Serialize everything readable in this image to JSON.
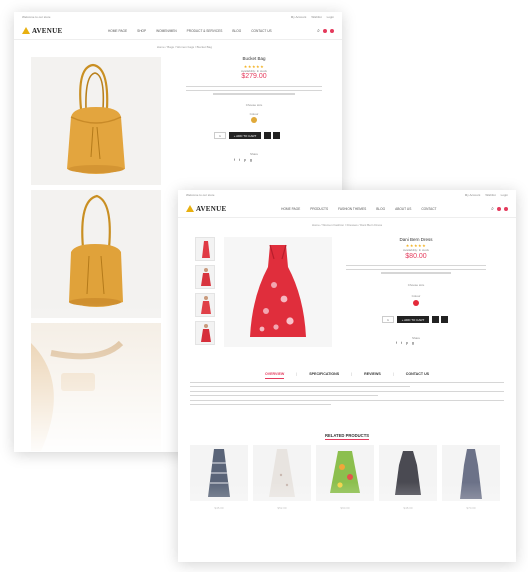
{
  "brand": {
    "logo_text": "AVENUE",
    "accent": "#e43a5c",
    "star_color": "#f2b01e"
  },
  "back_page": {
    "topbar_left": "Welcome to our store",
    "topbar_right": [
      "My Account",
      "Wishlist",
      "Login"
    ],
    "menu": [
      "Home page",
      "Shop",
      "Women/Men",
      "Product & Services",
      "Blog",
      "Contact us"
    ],
    "breadcrumb": "Home / Bags / Women bags / Bucket Bag",
    "product": {
      "name": "Bucket Bag",
      "price": "$279.00",
      "availability": "Availability: In stock",
      "size_label": "Choose size",
      "color_label": "Colour",
      "qty": "1",
      "cart_label": "+ ADD TO CART",
      "share_label": "Share",
      "swatch_color": "#e0a93a"
    }
  },
  "front_page": {
    "topbar_left": "Welcome to our store",
    "topbar_right": [
      "My Account",
      "Wishlist",
      "Login"
    ],
    "menu": [
      "Home page",
      "Products",
      "Fashion Themes",
      "Blog",
      "About us",
      "Contact"
    ],
    "breadcrumb": "Home / Women Fashion / Dresses / Dani Bern Dress",
    "product": {
      "name": "Dani Bern Dress",
      "price": "$80.00",
      "availability": "Availability: In stock",
      "size_label": "Choose size",
      "color_label": "Colour",
      "qty": "1",
      "cart_label": "+ ADD TO CART",
      "share_label": "Share",
      "swatch_color": "#e42a3a"
    },
    "tabs": [
      "OVERVIEW",
      "SPECIFICATIONS",
      "REVIEWS",
      "CONTACT US"
    ],
    "related_title": "RELATED PRODUCTS",
    "related": [
      {
        "name": "Striped Dress",
        "price": "$45.00",
        "color": "#5a6478"
      },
      {
        "name": "White Sundress",
        "price": "$52.00",
        "color": "#e8e4e0"
      },
      {
        "name": "Floral Dress",
        "price": "$60.00",
        "color": "#8cbf4e"
      },
      {
        "name": "Slip Dress",
        "price": "$48.00",
        "color": "#4a4a52"
      },
      {
        "name": "Long Dress",
        "price": "$70.00",
        "color": "#6c7288"
      }
    ]
  }
}
